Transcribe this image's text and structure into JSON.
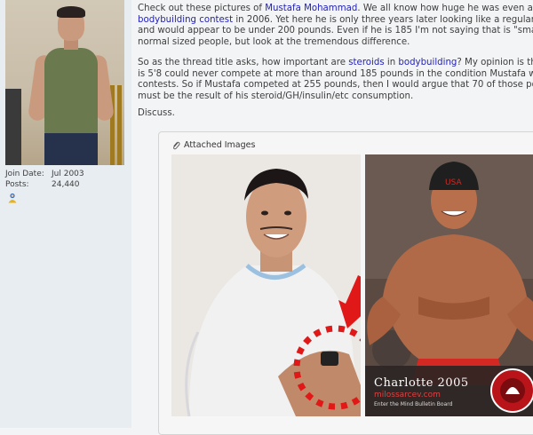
{
  "user": {
    "join_label": "Join Date:",
    "join_value": "Jul 2003",
    "posts_label": "Posts:",
    "posts_value": "24,440"
  },
  "post": {
    "p1_line1_a": "Check out these pictures of ",
    "p1_link1": "Mustafa Mohammad",
    "p1_line1_b": ". We all know how huge he was even as of",
    "p1_link2": "bodybuilding contest",
    "p1_line2_b": " in 2006. Yet here he is only three years later looking like a regular per",
    "p1_line3": "and would appear to be under 200 pounds. Even if he is 185 I'm not saying that is \"small\" c",
    "p1_line4": "normal sized people, but look at the tremendous difference.",
    "p2_line1_a": "So as the thread title asks, how important are ",
    "p2_link1": "steroids",
    "p2_line1_b": " in ",
    "p2_link2": "bodybuilding",
    "p2_line1_c": "? My opinion is that a",
    "p2_line2": "is 5'8 could never compete at more than around 185 pounds in the condition Mustafa was i",
    "p2_line3": "contests. So if Mustafa competed at 255 pounds, then I would argue that 70 of those pou",
    "p2_line4": "must be the result of his steroid/GH/insulin/etc consumption.",
    "p3": "Discuss."
  },
  "attachments": {
    "title": "Attached Images",
    "image2_caption": "Charlotte 2005",
    "image2_site": "milossarcev.com",
    "image2_tagline": "Enter the Mind Bulletin Board",
    "image2_cap_text": "USA",
    "logo_text": "KOLOSEUM GYM"
  },
  "colors": {
    "link": "#2222bb",
    "arrow_red": "#e01818",
    "background": "#f3f4f6",
    "sidebar": "#e8edf2"
  }
}
